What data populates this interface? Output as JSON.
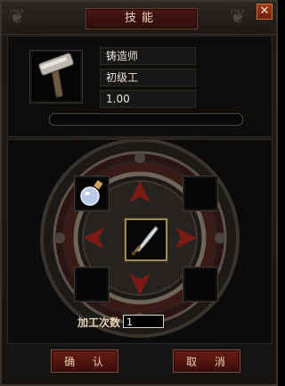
{
  "window": {
    "title": "技能",
    "close_glyph": "✕"
  },
  "skill": {
    "name": "铸造师",
    "rank": "初级工",
    "value": "1.00",
    "progress": 0.0,
    "item_icon": "hammer-icon"
  },
  "crafting": {
    "corner_slots": [
      {
        "name": "slot-top-left",
        "icon": "potion-flask-icon"
      },
      {
        "name": "slot-top-right",
        "icon": ""
      },
      {
        "name": "slot-bottom-left",
        "icon": ""
      },
      {
        "name": "slot-bottom-right",
        "icon": ""
      }
    ],
    "center_icon": "sword-icon",
    "quantity_label": "加工次数",
    "quantity_value": "1"
  },
  "buttons": {
    "confirm": "确 认",
    "cancel": "取 消"
  },
  "colors": {
    "gold_frame": "#9d8756",
    "button_red": "#6a1d14",
    "title_red": "#4a1714"
  }
}
